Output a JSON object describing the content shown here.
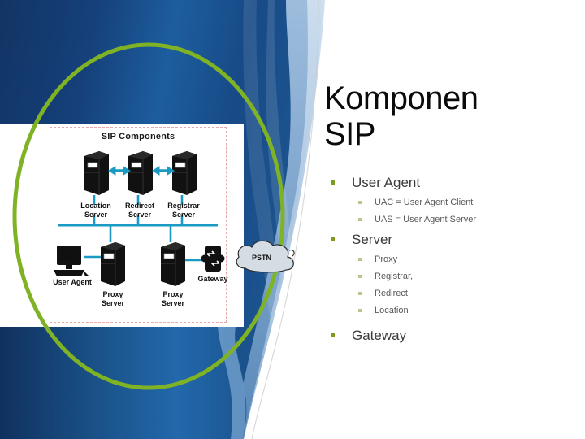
{
  "slide": {
    "title_line1": "Komponen",
    "title_line2": "SIP",
    "theme": {
      "background_blue_dark": "#143a6b",
      "background_blue_mid": "#1d5d9e",
      "accent_green": "#7fb325",
      "bullet_green": "#7d9b1e",
      "sub_bullet_green": "#b7c98a",
      "title_color": "#0a0a0a",
      "body_color": "#3b3b3b",
      "sub_body_color": "#595959",
      "swoosh_light_blue": "#8fb4d9"
    }
  },
  "outline": [
    {
      "label": "User Agent",
      "children": [
        "UAC = User Agent Client",
        "UAS = User Agent Server"
      ]
    },
    {
      "label": "Server",
      "children": [
        "Proxy",
        "Registrar,",
        "Redirect",
        "Location"
      ]
    },
    {
      "label": "Gateway",
      "children": []
    }
  ],
  "diagram": {
    "title": "SIP Components",
    "nodes": {
      "location_server": "Location\nServer",
      "location_server_l1": "Location",
      "location_server_l2": "Server",
      "redirect_server_l1": "Redirect",
      "redirect_server_l2": "Server",
      "registrar_server_l1": "Registrar",
      "registrar_server_l2": "Server",
      "user_agent": "User Agent",
      "proxy_server_1_l1": "Proxy",
      "proxy_server_1_l2": "Server",
      "proxy_server_2_l1": "Proxy",
      "proxy_server_2_l2": "Server",
      "gateway": "Gateway",
      "pstn_cloud": "PSTN"
    },
    "link_color": "#1b9bc4",
    "arrow_color": "#1b9bc4",
    "border_style": "dashed-pink"
  }
}
